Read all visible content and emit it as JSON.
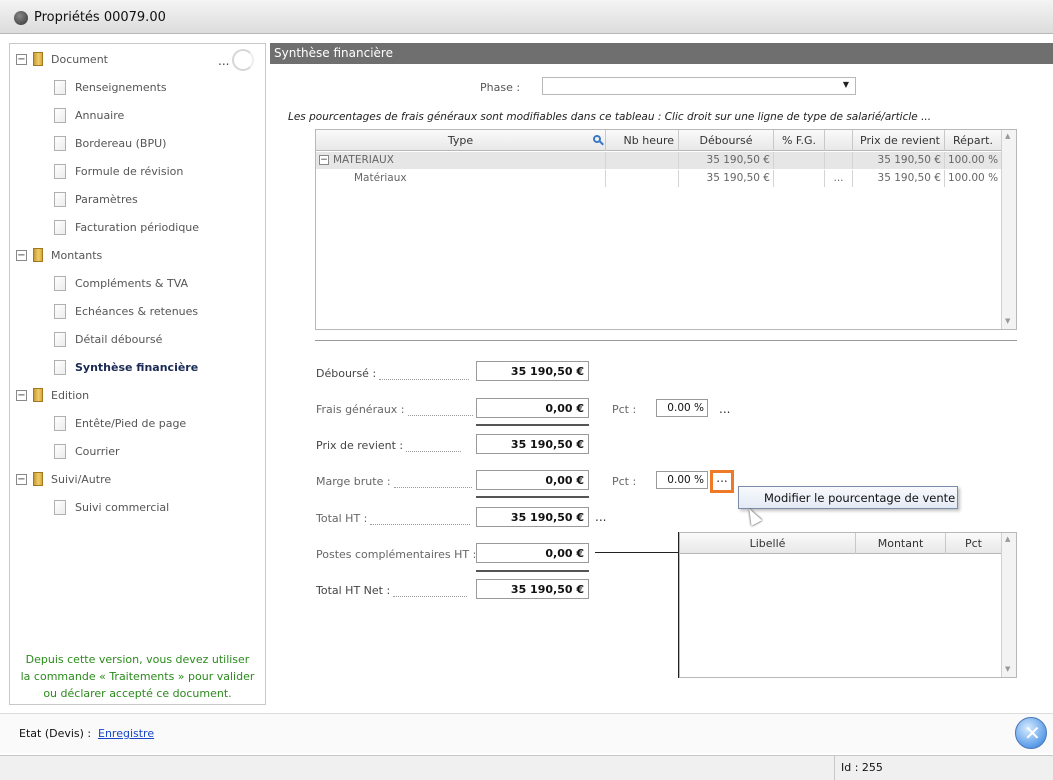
{
  "window": {
    "title": "Propriétés 00079.00"
  },
  "sidebar": {
    "more_label": "...",
    "items": [
      {
        "label": "Document",
        "type": "folder"
      },
      {
        "label": "Renseignements",
        "type": "page"
      },
      {
        "label": "Annuaire",
        "type": "page"
      },
      {
        "label": "Bordereau (BPU)",
        "type": "page"
      },
      {
        "label": "Formule de révision",
        "type": "page"
      },
      {
        "label": "Paramètres",
        "type": "page"
      },
      {
        "label": "Facturation périodique",
        "type": "page"
      },
      {
        "label": "Montants",
        "type": "folder"
      },
      {
        "label": "Compléments & TVA",
        "type": "page"
      },
      {
        "label": "Echéances & retenues",
        "type": "page"
      },
      {
        "label": "Détail déboursé",
        "type": "page"
      },
      {
        "label": "Synthèse financière",
        "type": "page",
        "selected": true
      },
      {
        "label": "Edition",
        "type": "folder"
      },
      {
        "label": "Entête/Pied de page",
        "type": "page"
      },
      {
        "label": "Courrier",
        "type": "page"
      },
      {
        "label": "Suivi/Autre",
        "type": "folder"
      },
      {
        "label": "Suivi commercial",
        "type": "page"
      }
    ],
    "expander_symbol": "⊟",
    "note_line1": "Depuis cette version, vous devez utiliser",
    "note_line2": "la commande « Traitements » pour valider",
    "note_line3": "ou déclarer accepté ce document."
  },
  "main": {
    "header": "Synthèse financière",
    "phase_label": "Phase :",
    "phase_value": "",
    "info": "Les pourcentages de frais généraux sont modifiables dans ce tableau : Clic droit sur une ligne de type de salarié/article ...",
    "grid": {
      "columns": [
        "Type",
        "Nb heure",
        "Déboursé",
        "% F.G.",
        "",
        "Prix de revient",
        "Répart."
      ],
      "rows": [
        {
          "type": "MATERIAUX",
          "nb_heure": "",
          "debourse": "35 190,50 €",
          "fg": "",
          "dots": "",
          "prix": "35 190,50 €",
          "repart": "100.00 %"
        },
        {
          "type": "Matériaux",
          "nb_heure": "",
          "debourse": "35 190,50 €",
          "fg": "",
          "dots": "...",
          "prix": "35 190,50 €",
          "repart": "100.00 %"
        }
      ]
    },
    "fields": {
      "debourse": {
        "label": "Déboursé :",
        "value": "35 190,50 €"
      },
      "frais_generaux": {
        "label": "Frais généraux :",
        "value": "0,00 €",
        "pct_label": "Pct :",
        "pct": "0.00 %"
      },
      "prix_revient": {
        "label": "Prix de revient :",
        "value": "35 190,50 €"
      },
      "marge_brute": {
        "label": "Marge brute :",
        "value": "0,00 €",
        "pct_label": "Pct :",
        "pct": "0.00 %"
      },
      "total_ht": {
        "label": "Total HT :",
        "value": "35 190,50 €"
      },
      "postes": {
        "label": "Postes complémentaires HT :",
        "value": "0,00 €"
      },
      "total_ht_net": {
        "label": "Total HT Net :",
        "value": "35 190,50 €"
      }
    },
    "ellipsis": "...",
    "sub_grid": {
      "columns": [
        "Libellé",
        "Montant",
        "Pct"
      ]
    },
    "context_menu": {
      "item": "Modifier le pourcentage de vente"
    }
  },
  "status": {
    "label": "Etat (Devis) :",
    "link": "Enregistre",
    "id": "Id : 255"
  },
  "colors": {
    "highlight": "#ee7a28",
    "note": "#2b8a1c",
    "link": "#1747c8"
  }
}
